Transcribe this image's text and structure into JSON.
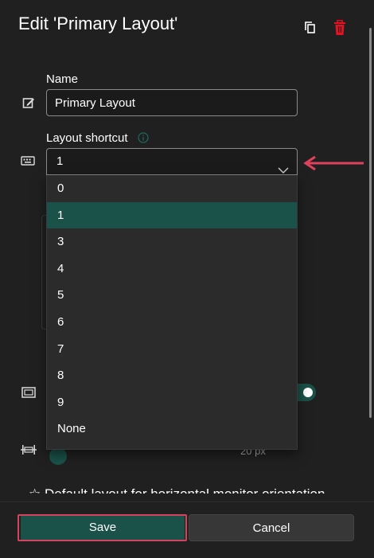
{
  "header": {
    "title": "Edit 'Primary Layout'",
    "duplicate_icon": "copy-icon",
    "delete_icon": "trash-icon",
    "delete_color": "#e81123"
  },
  "name_field": {
    "label": "Name",
    "value": "Primary Layout",
    "icon": "rename-icon"
  },
  "shortcut_field": {
    "label": "Layout shortcut",
    "info_icon": "info-icon",
    "icon": "keyboard-icon",
    "selected": "1",
    "options": [
      "0",
      "1",
      "3",
      "4",
      "5",
      "6",
      "7",
      "8",
      "9",
      "None"
    ]
  },
  "spacing": {
    "icon": "monitor-icon",
    "toggle_on": true,
    "distance_icon": "distance-icon",
    "distance_unit": "px",
    "distance_value_partial": "20"
  },
  "default_layout": {
    "icon": "star-icon",
    "label": "Default layout for horizontal monitor orientation"
  },
  "footer": {
    "save_label": "Save",
    "cancel_label": "Cancel"
  },
  "colors": {
    "accent": "#1a5249",
    "highlight_outline": "#d5445e",
    "annotation_arrow": "#e0425e"
  }
}
